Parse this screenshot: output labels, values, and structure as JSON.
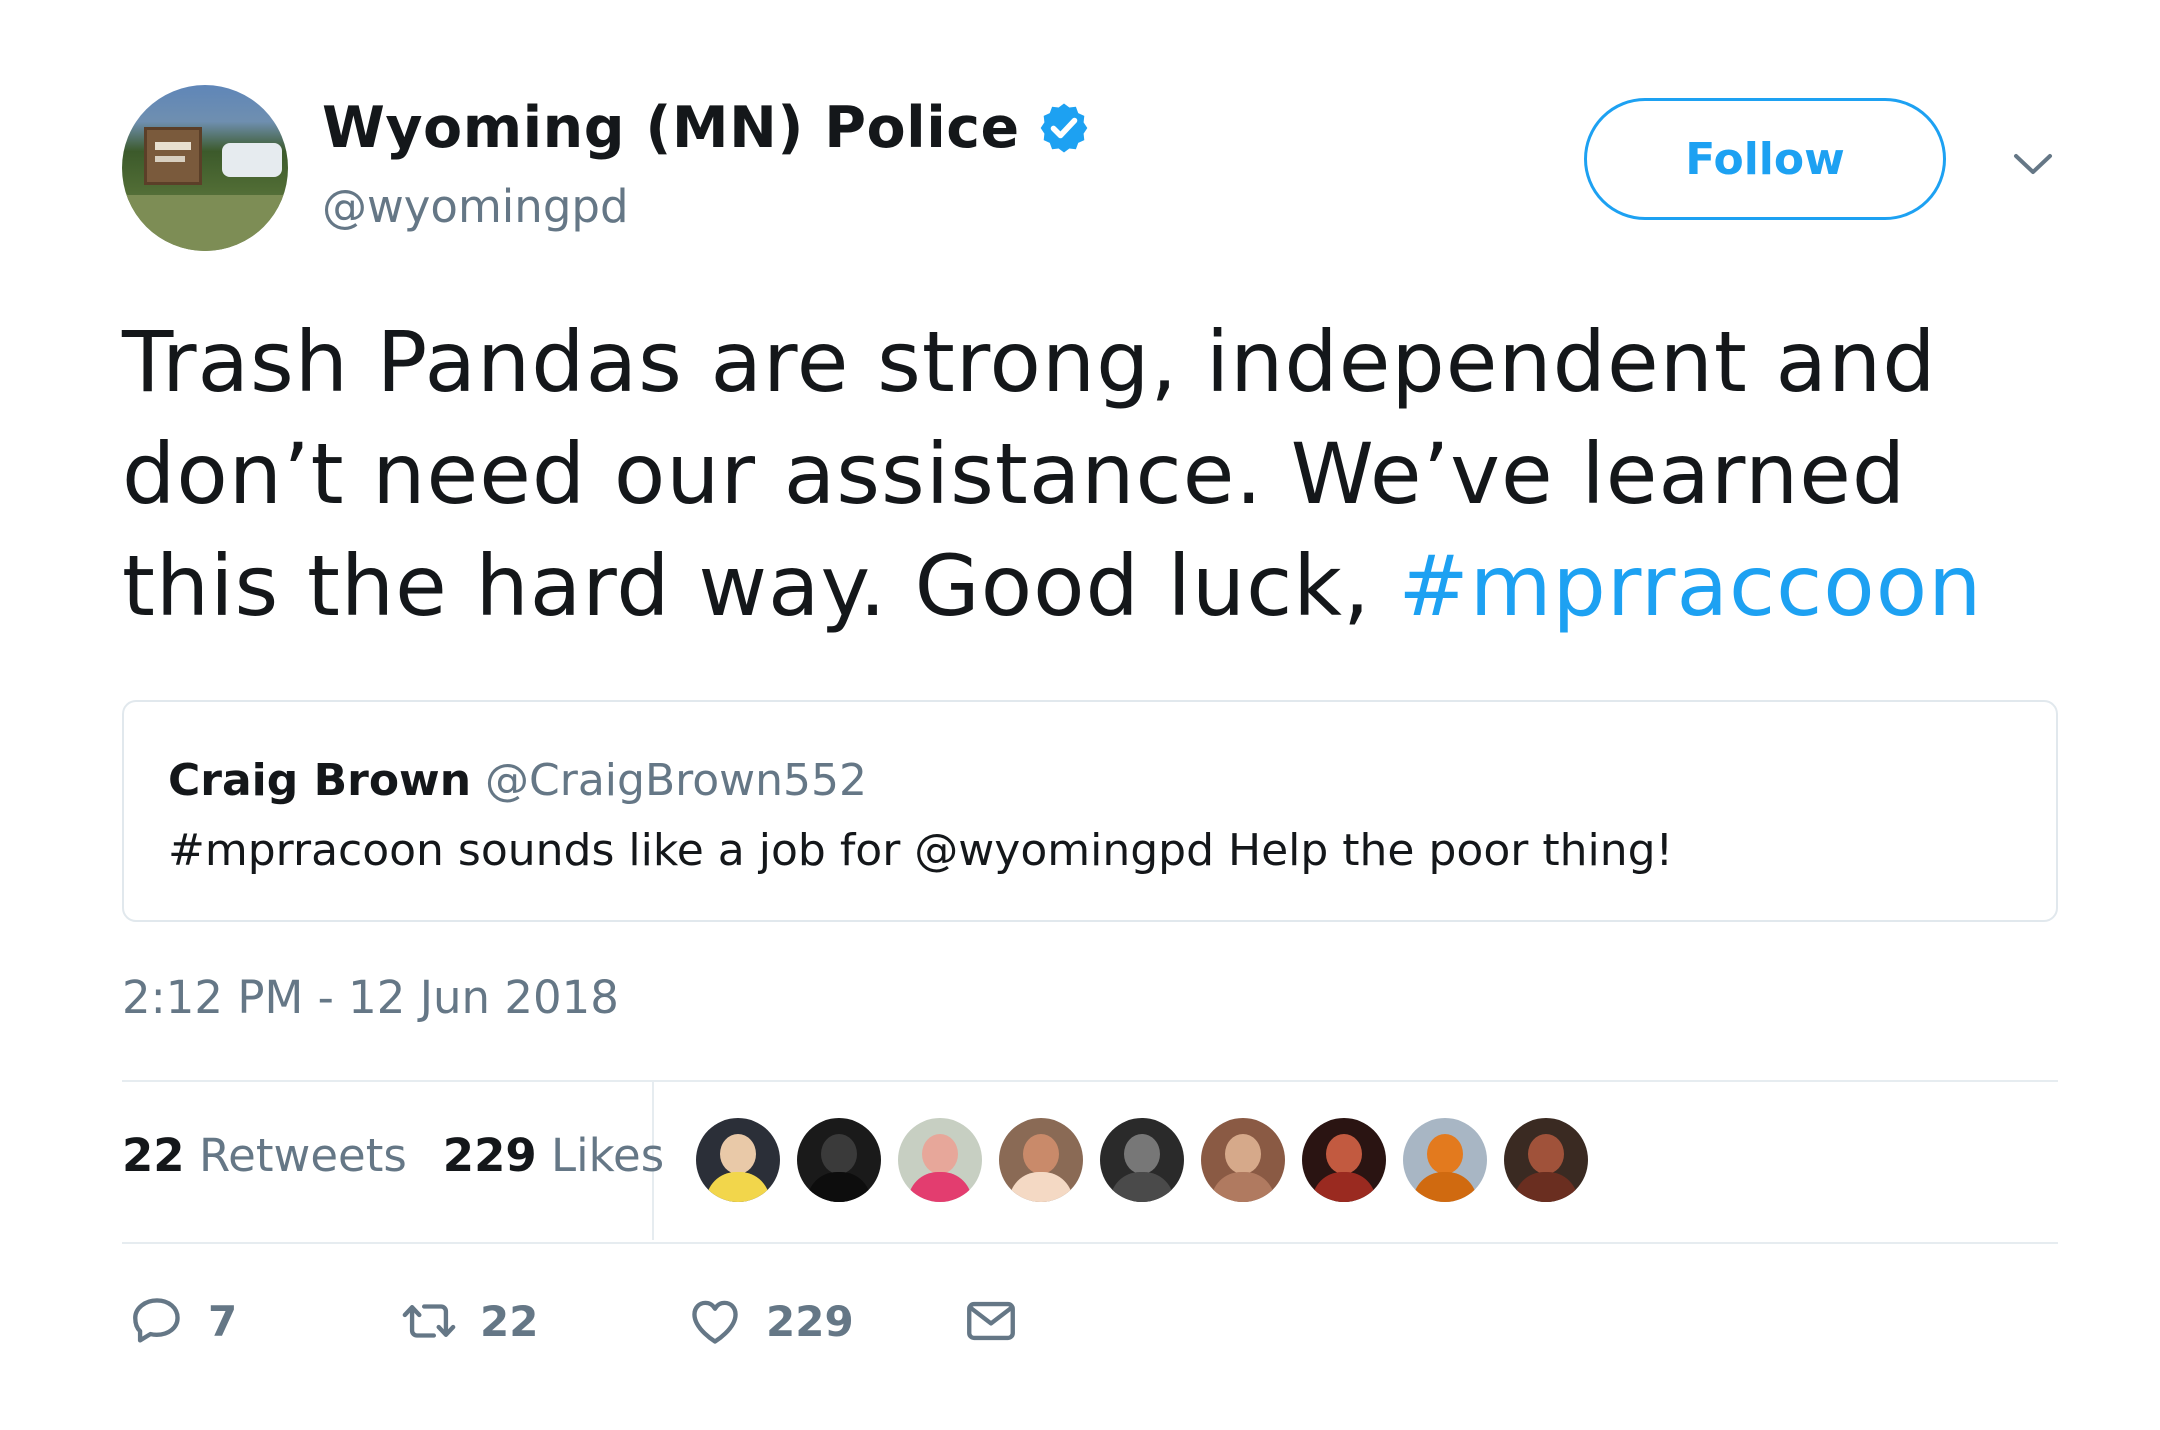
{
  "author": {
    "name": "Wyoming (MN) Police",
    "handle": "@wyomingpd",
    "verified": true
  },
  "follow_label": "Follow",
  "tweet": {
    "text": "Trash Pandas are strong, independent and don’t need our assistance. We’ve learned this the hard way. Good luck, ",
    "hashtag": "#mprraccoon"
  },
  "quoted": {
    "name": "Craig Brown",
    "handle": "@CraigBrown552",
    "text": "#mprracoon sounds like a job for @wyomingpd Help the poor thing!"
  },
  "timestamp": "2:12 PM - 12 Jun 2018",
  "stats": {
    "retweets_count": "22",
    "retweets_label": "Retweets",
    "likes_count": "229",
    "likes_label": "Likes"
  },
  "likers": [
    {
      "bg": "#2b2f38",
      "face": "#e9c9a8",
      "body": "#f2d64b"
    },
    {
      "bg": "#1a1a1a",
      "face": "#3a3a3a",
      "body": "#0d0d0d"
    },
    {
      "bg": "#c7cfc2",
      "face": "#e7a79a",
      "body": "#e33d6f"
    },
    {
      "bg": "#8a6a55",
      "face": "#c98a6a",
      "body": "#f4d9c4"
    },
    {
      "bg": "#2a2a2a",
      "face": "#777777",
      "body": "#4a4a4a"
    },
    {
      "bg": "#8a5a44",
      "face": "#d6a98a",
      "body": "#b07a60"
    },
    {
      "bg": "#2a1412",
      "face": "#c25a40",
      "body": "#9a2a20"
    },
    {
      "bg": "#a8b6c4",
      "face": "#e37a1e",
      "body": "#d06a10"
    },
    {
      "bg": "#3a2a22",
      "face": "#a0523a",
      "body": "#6a2e20"
    }
  ],
  "actions": {
    "reply_count": "7",
    "retweet_count": "22",
    "like_count": "229"
  },
  "colors": {
    "accent": "#1da1f2",
    "secondary_text": "#657786",
    "primary_text": "#14171a",
    "border": "#e1e8ed"
  },
  "icons": [
    "verified-badge-icon",
    "chevron-down-icon",
    "reply-icon",
    "retweet-icon",
    "heart-icon",
    "mail-icon"
  ]
}
